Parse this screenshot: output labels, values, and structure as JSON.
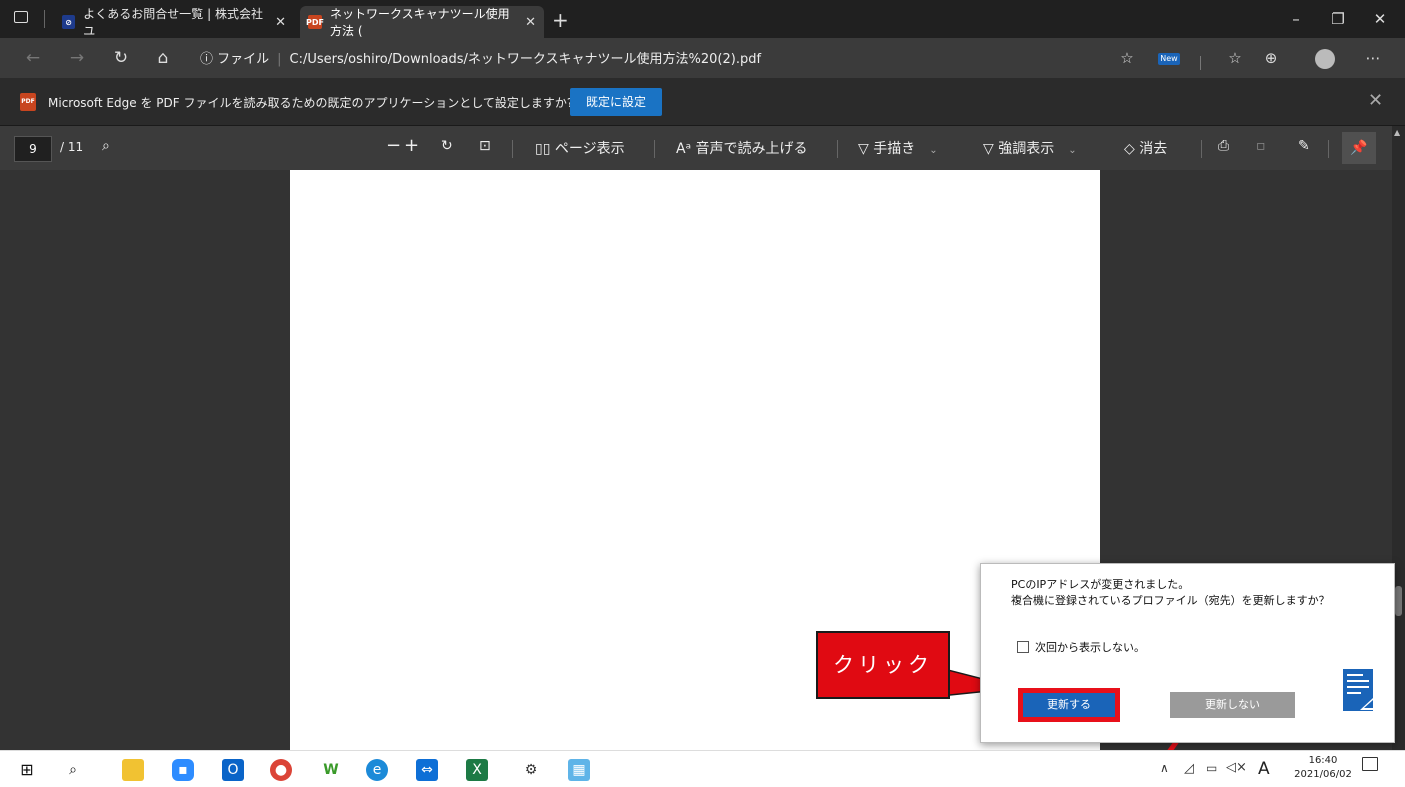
{
  "browser": {
    "tabs": [
      {
        "label": "よくあるお問合せ一覧 | 株式会社ユ",
        "active": false
      },
      {
        "label": "ネットワークスキャナツール使用方法 (",
        "active": true
      }
    ],
    "new_tab": "+",
    "window": {
      "minimize": "–",
      "restore": "❐",
      "close": "✕"
    },
    "address": {
      "info": "ⓘ ファイル",
      "url": "C:/Users/oshiro/Downloads/ネットワークスキャナツール使用方法%20(2).pdf"
    },
    "new_badge": "New"
  },
  "infobar": {
    "icon": "PDF",
    "message": "Microsoft Edge を PDF ファイルを読み取るための既定のアプリケーションとして設定しますか?",
    "button": "既定に設定"
  },
  "pdf_toolbar": {
    "page_current": "9",
    "page_total": "/ 11",
    "page_view": "ページ表示",
    "read_aloud": "音声で読み上げる",
    "draw": "手描き",
    "highlight": "強調表示",
    "erase": "消去"
  },
  "dialog": {
    "line1": "PCのIPアドレスが変更されました。",
    "line2": "複合機に登録されているプロファイル（宛先）を更新しますか？",
    "checkbox_label": "次回から表示しない。",
    "update_button": "更新する",
    "no_update_button": "更新しない"
  },
  "callout": {
    "text": "クリック"
  },
  "taskbar": {
    "time": "16:40",
    "date": "2021/06/02",
    "ime": "A"
  },
  "colors": {
    "accent": "#1a73c4",
    "callout_red": "#e00a12"
  }
}
